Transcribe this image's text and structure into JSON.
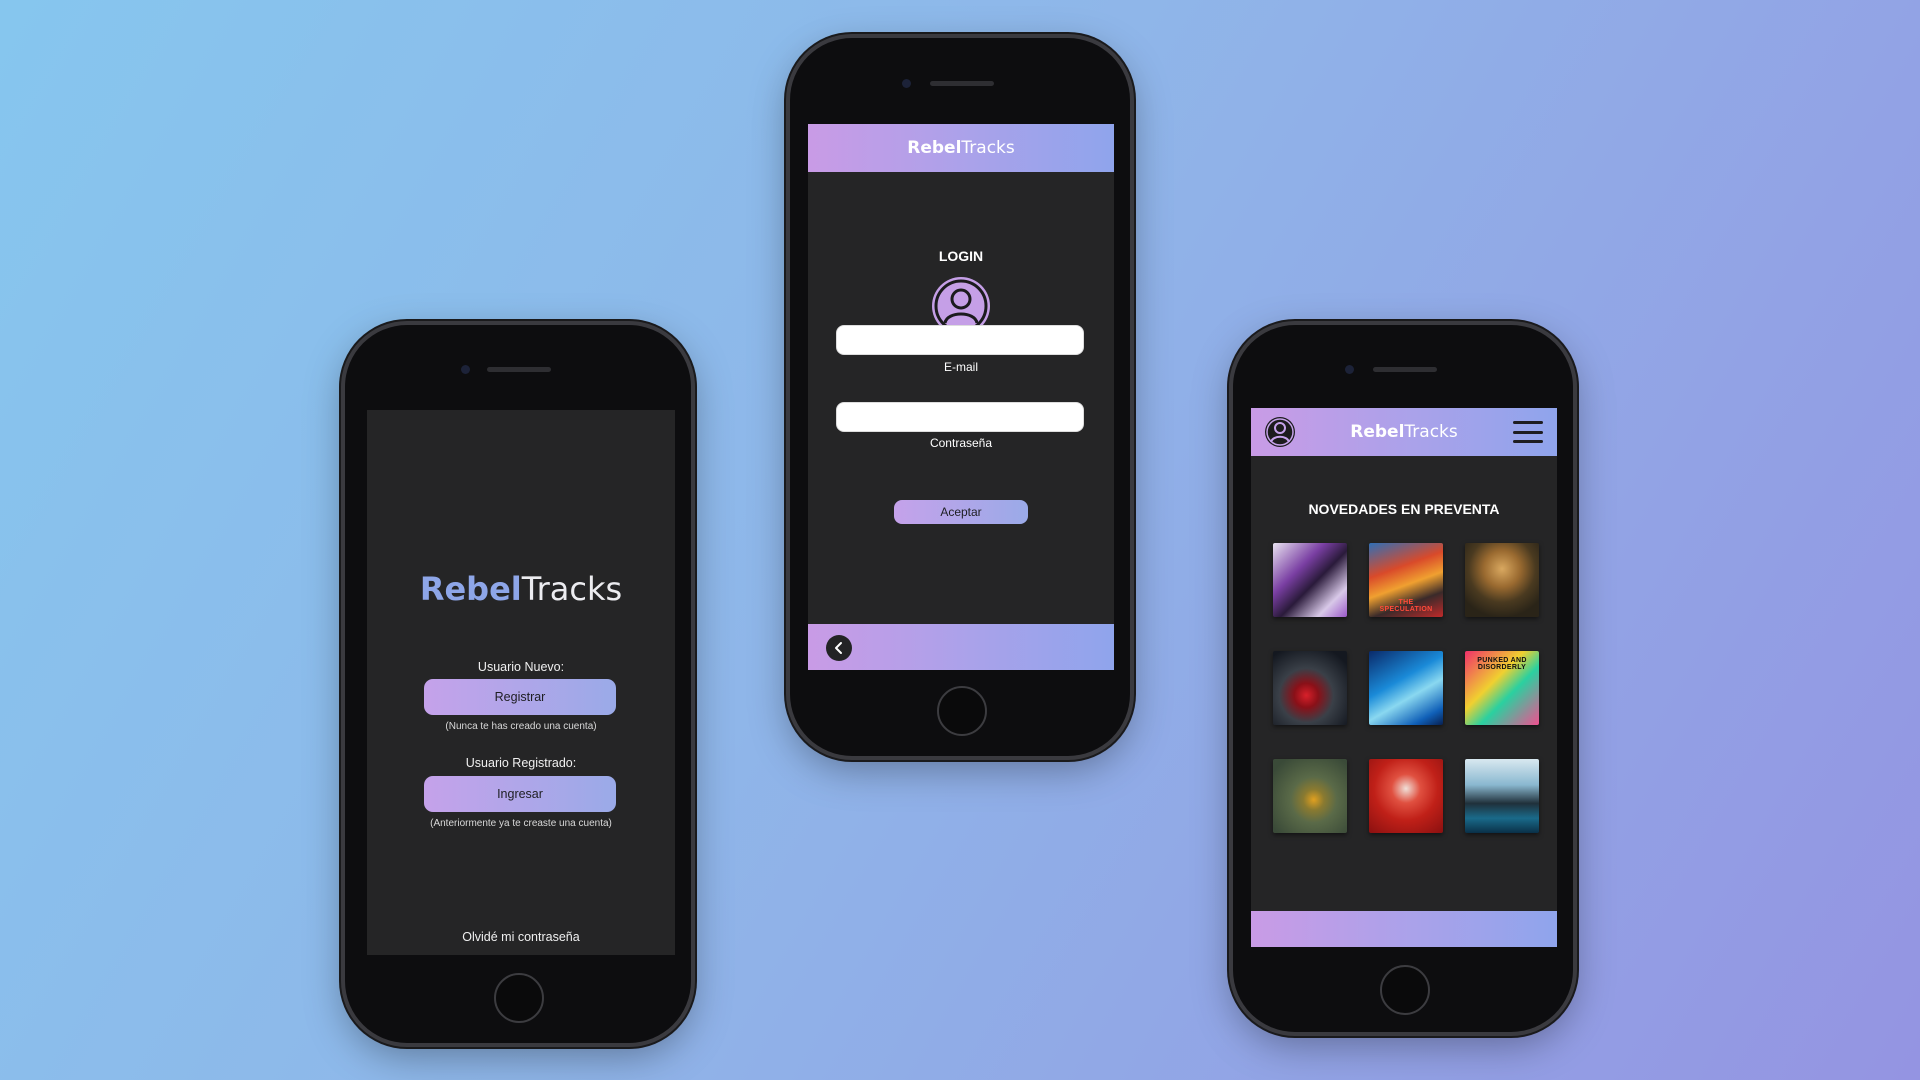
{
  "brand": {
    "bold": "Rebel",
    "light": "Tracks"
  },
  "colors": {
    "accent_start": "#c99be6",
    "accent_end": "#8fa4ec",
    "screen_bg": "#252526"
  },
  "welcome": {
    "new_user_label": "Usuario Nuevo:",
    "register_button": "Registrar",
    "register_hint": "(Nunca te has creado una cuenta)",
    "registered_label": "Usuario Registrado:",
    "login_button": "Ingresar",
    "login_hint": "(Anteriormente ya te creaste una cuenta)",
    "forgot_password": "Olvidé mi contraseña"
  },
  "login": {
    "title": "LOGIN",
    "email_label": "E-mail",
    "email_value": "",
    "password_label": "Contraseña",
    "password_value": "",
    "accept_button": "Aceptar",
    "back_icon": "chevron-left-icon"
  },
  "home": {
    "section_title": "NOVEDADES EN PREVENTA",
    "menu_icon": "hamburger-menu-icon",
    "profile_icon": "user-icon",
    "albums": [
      {
        "art": "purple-collage",
        "caption": ""
      },
      {
        "art": "fire-collage",
        "caption": "THE SPECULATION"
      },
      {
        "art": "mona-lisa",
        "caption": ""
      },
      {
        "art": "red-lips",
        "caption": ""
      },
      {
        "art": "blue-hand",
        "caption": ""
      },
      {
        "art": "punked-skull",
        "caption": "PUNKED AND DISORDERLY"
      },
      {
        "art": "bird-green",
        "caption": ""
      },
      {
        "art": "red-figure",
        "caption": ""
      },
      {
        "art": "sea-silhouettes",
        "caption": ""
      }
    ]
  }
}
